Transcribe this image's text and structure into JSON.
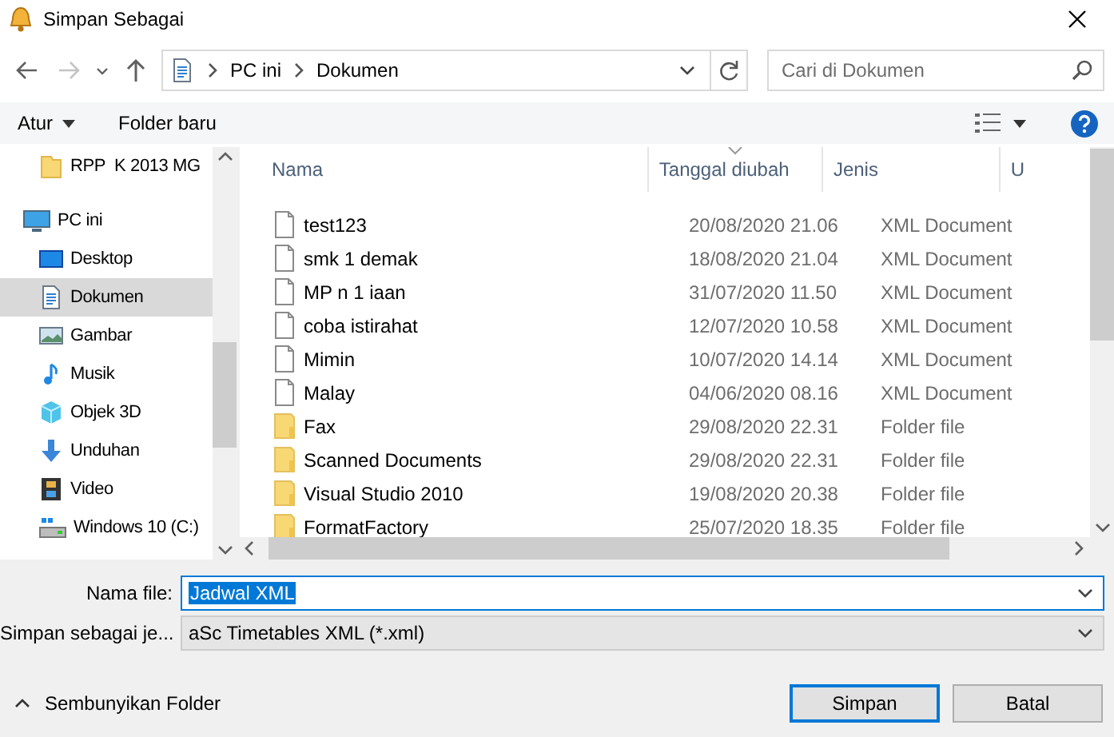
{
  "window": {
    "title": "Simpan Sebagai"
  },
  "navigation": [
    {
      "kind": "back",
      "disabled": false
    },
    {
      "kind": "forward",
      "disabled": true
    },
    {
      "kind": "recent",
      "disabled": false
    },
    {
      "kind": "up",
      "disabled": false
    }
  ],
  "address": {
    "path": [
      "PC ini",
      "Dokumen"
    ]
  },
  "search": {
    "placeholder": "Cari di Dokumen"
  },
  "toolbar": {
    "organize": "Atur",
    "new_folder": "Folder baru"
  },
  "sidebar": {
    "items": [
      {
        "label": "RPP  K 2013 MG",
        "kind": "folder",
        "selected": false
      },
      {
        "label": "PC ini",
        "kind": "pc",
        "selected": false,
        "children": [
          {
            "label": "Desktop",
            "kind": "desktop",
            "selected": false
          },
          {
            "label": "Dokumen",
            "kind": "documents",
            "selected": true
          },
          {
            "label": "Gambar",
            "kind": "pictures",
            "selected": false
          },
          {
            "label": "Musik",
            "kind": "music",
            "selected": false
          },
          {
            "label": "Objek 3D",
            "kind": "objects3d",
            "selected": false
          },
          {
            "label": "Unduhan",
            "kind": "downloads",
            "selected": false
          },
          {
            "label": "Video",
            "kind": "video",
            "selected": false
          },
          {
            "label": "Windows 10 (C:)",
            "kind": "drive",
            "selected": false
          }
        ]
      }
    ]
  },
  "file_list": {
    "columns": [
      {
        "label": "Nama",
        "sorted": false
      },
      {
        "label": "Tanggal diubah",
        "sorted": true
      },
      {
        "label": "Jenis",
        "sorted": false
      },
      {
        "label": "U",
        "sorted": false
      }
    ],
    "rows": [
      {
        "name": "test123",
        "date": "20/08/2020 21.06",
        "type": "XML Document",
        "kind": "document"
      },
      {
        "name": "smk 1 demak",
        "date": "18/08/2020 21.04",
        "type": "XML Document",
        "kind": "document"
      },
      {
        "name": "MP n 1 iaan",
        "date": "31/07/2020 11.50",
        "type": "XML Document",
        "kind": "document"
      },
      {
        "name": "coba istirahat",
        "date": "12/07/2020 10.58",
        "type": "XML Document",
        "kind": "document"
      },
      {
        "name": "Mimin",
        "date": "10/07/2020 14.14",
        "type": "XML Document",
        "kind": "document"
      },
      {
        "name": "Malay",
        "date": "04/06/2020 08.16",
        "type": "XML Document",
        "kind": "document"
      },
      {
        "name": "Fax",
        "date": "29/08/2020 22.31",
        "type": "Folder file",
        "kind": "folder"
      },
      {
        "name": "Scanned Documents",
        "date": "29/08/2020 22.31",
        "type": "Folder file",
        "kind": "folder"
      },
      {
        "name": "Visual Studio 2010",
        "date": "19/08/2020 20.38",
        "type": "Folder file",
        "kind": "folder"
      },
      {
        "name": "FormatFactory",
        "date": "25/07/2020 18.35",
        "type": "Folder file",
        "kind": "folder"
      }
    ]
  },
  "form": {
    "file_name": {
      "label": "Nama file:",
      "value": "Jadwal XML",
      "text_selected": true
    },
    "file_type": {
      "label": "Simpan sebagai je...",
      "value": "aSc Timetables XML (*.xml)"
    }
  },
  "hide_folders": "Sembunyikan Folder",
  "buttons": [
    {
      "label": "Simpan",
      "kind": "primary"
    },
    {
      "label": "Batal",
      "kind": "secondary"
    }
  ]
}
